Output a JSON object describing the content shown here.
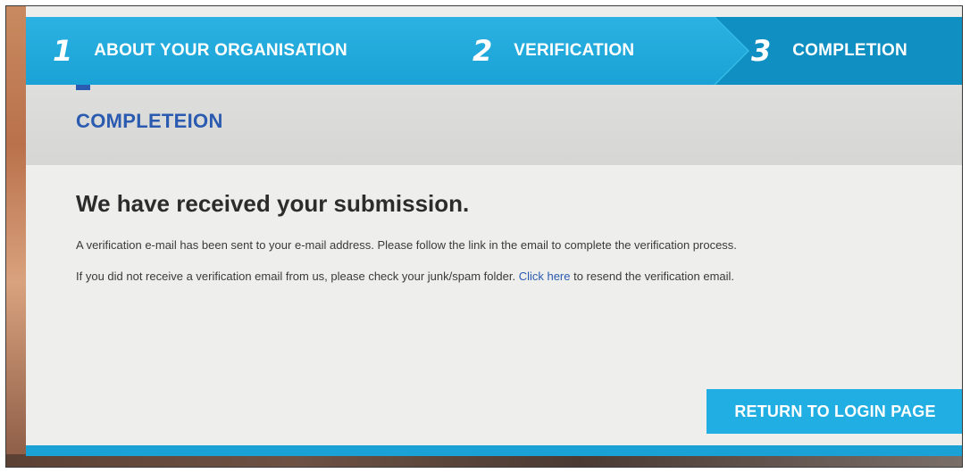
{
  "steps": [
    {
      "number": "1",
      "label": "ABOUT YOUR ORGANISATION"
    },
    {
      "number": "2",
      "label": "VERIFICATION"
    },
    {
      "number": "3",
      "label": "COMPLETION"
    }
  ],
  "section": {
    "title": "COMPLETEION"
  },
  "content": {
    "headline": "We have received your submission.",
    "paragraph1": "A verification e-mail has been sent to your e-mail address. Please follow the link in the email to complete the verification process.",
    "paragraph2_before": "If you did not receive a verification email from us, please check your junk/spam folder. ",
    "paragraph2_link": "Click here",
    "paragraph2_after": " to resend the verification email."
  },
  "actions": {
    "return_label": "RETURN TO LOGIN PAGE"
  },
  "colors": {
    "accent": "#21aee2",
    "active_step": "#0f8fc2",
    "title_blue": "#2a5bb0"
  }
}
